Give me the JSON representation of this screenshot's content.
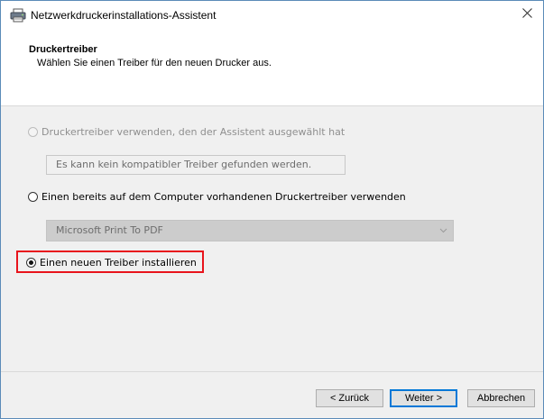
{
  "window": {
    "title": "Netzwerkdruckerinstallations-Assistent",
    "close_glyph": "✕"
  },
  "header": {
    "title": "Druckertreiber",
    "subtitle": "Wählen Sie einen Treiber für den neuen Drucker aus."
  },
  "options": {
    "wizard_driver": {
      "label": "Druckertreiber verwenden, den der Assistent ausgewählt hat",
      "state": "disabled",
      "info_text": "Es kann kein kompatibler Treiber gefunden werden."
    },
    "existing_driver": {
      "label": "Einen bereits auf dem Computer vorhandenen Druckertreiber verwenden",
      "state": "unselected",
      "dropdown_value": "Microsoft Print To PDF"
    },
    "new_driver": {
      "label": "Einen neuen Treiber installieren",
      "state": "selected"
    }
  },
  "buttons": {
    "back": "< Zurück",
    "next": "Weiter >",
    "cancel": "Abbrechen"
  },
  "colors": {
    "highlight": "#e8141c",
    "accent": "#0078d7"
  }
}
